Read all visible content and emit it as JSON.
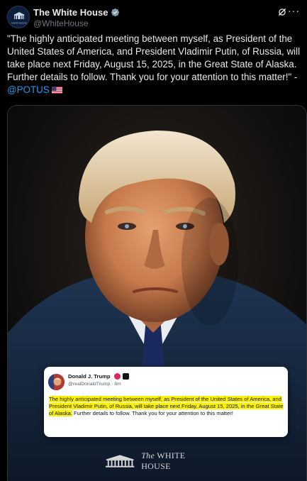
{
  "post": {
    "author": {
      "display_name": "The White House",
      "handle": "@WhiteHouse",
      "avatar_text": "WHITE HOUSE"
    },
    "text_part1": "\"The highly anticipated meeting between myself, as President of the United States of America, and President Vladimir Putin, of Russia, will take place next Friday, August 15, 2025, in the Great State of Alaska. Further details to follow. Thank you for your attention to this matter!\" - ",
    "mention": "@POTUS",
    "icons": {
      "verified": "verified-badge-icon",
      "grok": "grok-icon",
      "more": "more-icon",
      "flag": "us-flag-icon"
    }
  },
  "media": {
    "embedded_post": {
      "name": "Donald J. Trump",
      "handle": "@realDonaldTrump · 8m",
      "highlighted_text": "The highly anticipated meeting between myself, as President of the United States of America, and President Vladimir Putin, of Russia, will take place next Friday, August 15, 2025, in the Great State of Alaska.",
      "plain_text": " Further details to follow. Thank you for your attention to this matter!"
    },
    "watermark": {
      "the": "The",
      "name": "WHITE HOUSE"
    }
  },
  "colors": {
    "background": "#000000",
    "text": "#e7e9ea",
    "secondary_text": "#71767b",
    "link": "#1d9bf0",
    "highlight": "#fff200"
  }
}
